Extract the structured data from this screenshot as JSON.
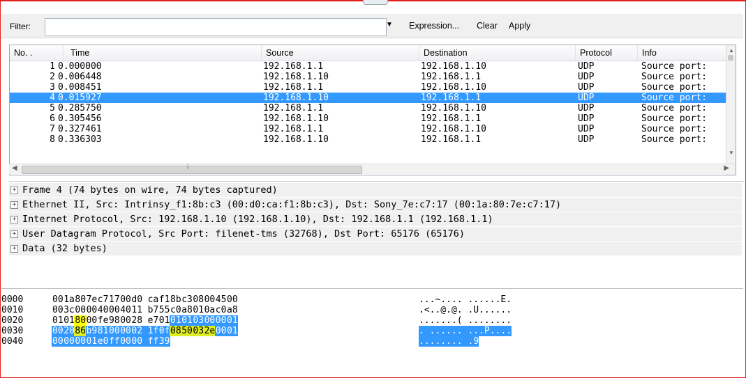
{
  "filter": {
    "label": "Filter:",
    "value": "",
    "expression_label": "Expression...",
    "clear_label": "Clear",
    "apply_label": "Apply"
  },
  "columns": [
    "No. .",
    "Time",
    "Source",
    "Destination",
    "Protocol",
    "Info"
  ],
  "packets": [
    {
      "no": "1",
      "time": "0.000000",
      "src": "192.168.1.1",
      "dst": "192.168.1.10",
      "proto": "UDP",
      "info": "Source port:"
    },
    {
      "no": "2",
      "time": "0.006448",
      "src": "192.168.1.10",
      "dst": "192.168.1.1",
      "proto": "UDP",
      "info": "Source port:"
    },
    {
      "no": "3",
      "time": "0.008451",
      "src": "192.168.1.1",
      "dst": "192.168.1.10",
      "proto": "UDP",
      "info": "Source port:"
    },
    {
      "no": "4",
      "time": "0.015927",
      "src": "192.168.1.10",
      "dst": "192.168.1.1",
      "proto": "UDP",
      "info": "Source port:",
      "selected": true
    },
    {
      "no": "5",
      "time": "0.285750",
      "src": "192.168.1.1",
      "dst": "192.168.1.10",
      "proto": "UDP",
      "info": "Source port:"
    },
    {
      "no": "6",
      "time": "0.305456",
      "src": "192.168.1.10",
      "dst": "192.168.1.1",
      "proto": "UDP",
      "info": "Source port:"
    },
    {
      "no": "7",
      "time": "0.327461",
      "src": "192.168.1.1",
      "dst": "192.168.1.10",
      "proto": "UDP",
      "info": "Source port:"
    },
    {
      "no": "8",
      "time": "0.336303",
      "src": "192.168.1.10",
      "dst": "192.168.1.1",
      "proto": "UDP",
      "info": "Source port:"
    }
  ],
  "details": [
    "Frame 4 (74 bytes on wire, 74 bytes captured)",
    "Ethernet II, Src: Intrinsy_f1:8b:c3 (00:d0:ca:f1:8b:c3), Dst: Sony_7e:c7:17 (00:1a:80:7e:c7:17)",
    "Internet Protocol, Src: 192.168.1.10 (192.168.1.10), Dst: 192.168.1.1 (192.168.1.1)",
    "User Datagram Protocol, Src Port: filenet-tms (32768), Dst Port: 65176 (65176)",
    "Data (32 bytes)"
  ],
  "hex_rows": [
    {
      "offset": "0000",
      "bytes": [
        "00",
        "1a",
        "80",
        "7e",
        "c7",
        "17",
        "00",
        "d0",
        "ca",
        "f1",
        "8b",
        "c3",
        "08",
        "00",
        "45",
        "00"
      ],
      "ascii": "...~.... ......E."
    },
    {
      "offset": "0010",
      "bytes": [
        "00",
        "3c",
        "00",
        "00",
        "40",
        "00",
        "40",
        "11",
        "b7",
        "55",
        "c0",
        "a8",
        "01",
        "0a",
        "c0",
        "a8"
      ],
      "ascii": ".<..@.@. .U......"
    },
    {
      "offset": "0020",
      "bytes": [
        "01",
        "01",
        "80",
        "00",
        "fe",
        "98",
        "00",
        "28",
        "e7",
        "01",
        "01",
        "01",
        "03",
        "00",
        "00",
        "01"
      ],
      "ascii": ".......( ........"
    },
    {
      "offset": "0030",
      "bytes": [
        "00",
        "20",
        "86",
        "b9",
        "81",
        "00",
        "00",
        "02",
        "1f",
        "0f",
        "08",
        "50",
        "03",
        "2e",
        "00",
        "01"
      ],
      "ascii": ". ...... ...P...."
    },
    {
      "offset": "0040",
      "bytes": [
        "00",
        "00",
        "00",
        "01",
        "e0",
        "ff",
        "00",
        "00",
        "ff",
        "39"
      ],
      "ascii": "........ .9"
    }
  ],
  "colors": {
    "selection": "#3399ff",
    "highlight": "#ffff00",
    "border": "#e0201b"
  }
}
